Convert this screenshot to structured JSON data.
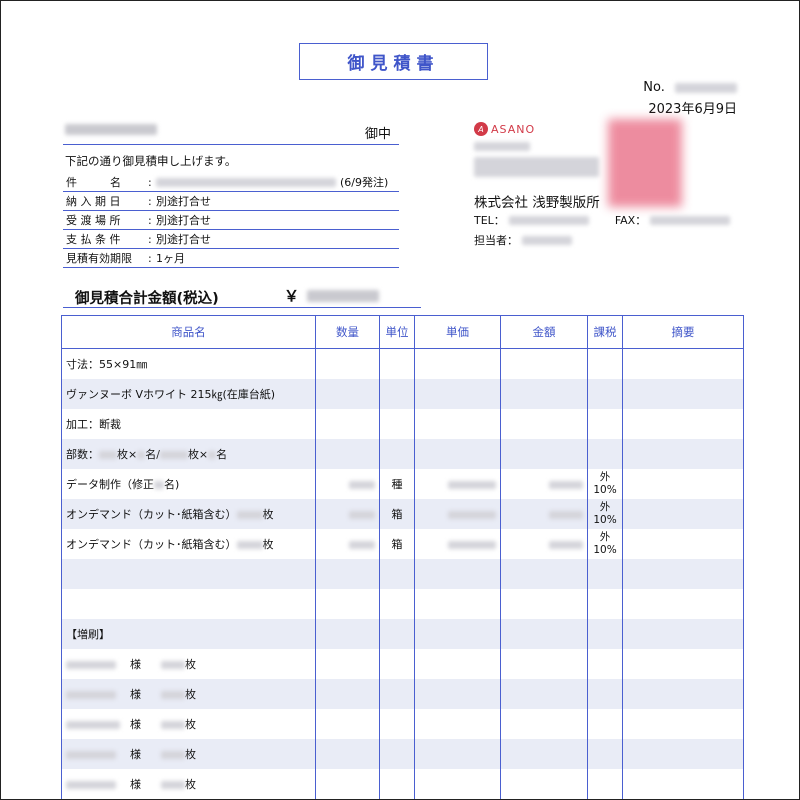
{
  "title": "御見積書",
  "doc_no_label": "No.",
  "date": "2023年6月9日",
  "client_suffix": "御中",
  "intro": "下記の通り御見積申し上げます。",
  "info": [
    {
      "key": "件　　　名",
      "value": "(6/9発注)"
    },
    {
      "key": "納 入 期 日",
      "value": "別途打合せ"
    },
    {
      "key": "受 渡 場 所",
      "value": "別途打合せ"
    },
    {
      "key": "支 払 条 件",
      "value": "別途打合せ"
    },
    {
      "key": "見積有効期限",
      "value": "1ヶ月"
    }
  ],
  "logo_text": "ASANO",
  "company": "株式会社 浅野製版所",
  "tel_label": "TEL：",
  "fax_label": "FAX：",
  "person_label": "担当者：",
  "total_label": "御見積合計金額(税込)",
  "yen": "￥",
  "columns": [
    "商品名",
    "数量",
    "単位",
    "単価",
    "金額",
    "課税",
    "摘要"
  ],
  "rows": [
    {
      "name": "寸法：55×91㎜"
    },
    {
      "name": "ヴァンヌーボ Vホワイト 215㎏(在庫台紙)"
    },
    {
      "name": "加工：断裁"
    },
    {
      "name_parts": [
        "部数：",
        "枚×",
        "名/",
        "枚×",
        "名"
      ]
    },
    {
      "name": "データ制作（修正",
      "name_tail": "名)",
      "unit": "種",
      "tax1": "外",
      "tax2": "10%"
    },
    {
      "name": "オンデマンド（カット･紙箱含む）",
      "name_tail": "枚",
      "unit": "箱",
      "tax1": "外",
      "tax2": "10%"
    },
    {
      "name": "オンデマンド（カット･紙箱含む）",
      "name_tail": "枚",
      "unit": "箱",
      "tax1": "外",
      "tax2": "10%"
    },
    {
      "name": ""
    },
    {
      "name": ""
    },
    {
      "name": "【増刷】"
    },
    {
      "name": "様",
      "name_tail": "枚"
    },
    {
      "name": "様",
      "name_tail": "枚"
    },
    {
      "name": "様",
      "name_tail": "枚"
    },
    {
      "name": "様",
      "name_tail": "枚"
    },
    {
      "name": "様",
      "name_tail": "枚"
    }
  ],
  "colors": {
    "accent": "#4a5fd0",
    "title_text": "#3f55c9",
    "row_alt": "#e9ecf6",
    "logo": "#d23a48"
  }
}
